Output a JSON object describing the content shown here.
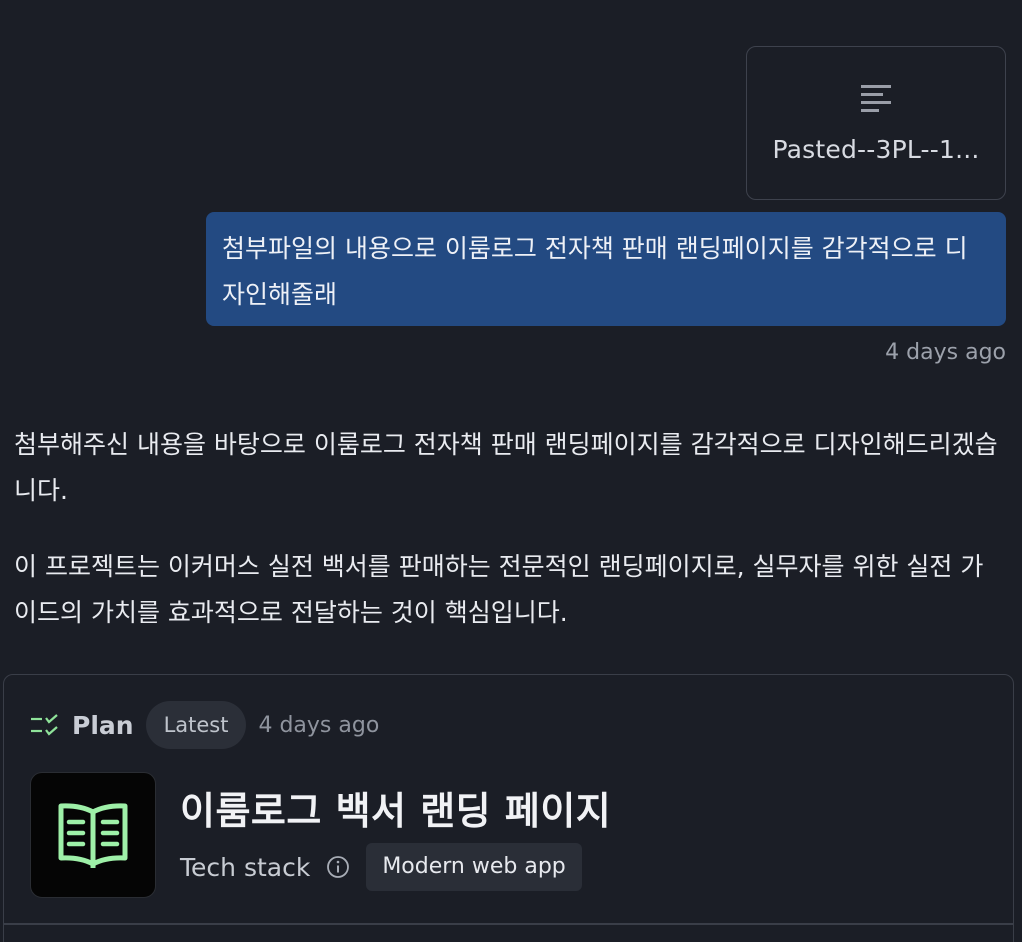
{
  "attachment": {
    "name": "Pasted--3PL--1...",
    "icon": "text-file-icon"
  },
  "user_message": {
    "text": "첨부파일의 내용으로 이룸로그 전자책 판매 랜딩페이지를 감각적으로 디자인해줄래",
    "timestamp": "4 days ago"
  },
  "assistant_message": {
    "paragraphs": [
      "첨부해주신 내용을 바탕으로 이룸로그 전자책 판매 랜딩페이지를 감각적으로 디자인해드리겠습니다.",
      "이 프로젝트는 이커머스 실전 백서를 판매하는 전문적인 랜딩페이지로, 실무자를 위한 실전 가이드의 가치를 효과적으로 전달하는 것이 핵심입니다."
    ]
  },
  "plan": {
    "label": "Plan",
    "badge": "Latest",
    "timestamp": "4 days ago",
    "app_icon": "open-book-icon",
    "title": "이룸로그 백서 랜딩 페이지",
    "tech_stack_label": "Tech stack",
    "tech_stack_value": "Modern web app"
  },
  "colors": {
    "background": "#1b1e26",
    "user_bubble": "#234a82",
    "accent_green": "#9ef0a8"
  }
}
